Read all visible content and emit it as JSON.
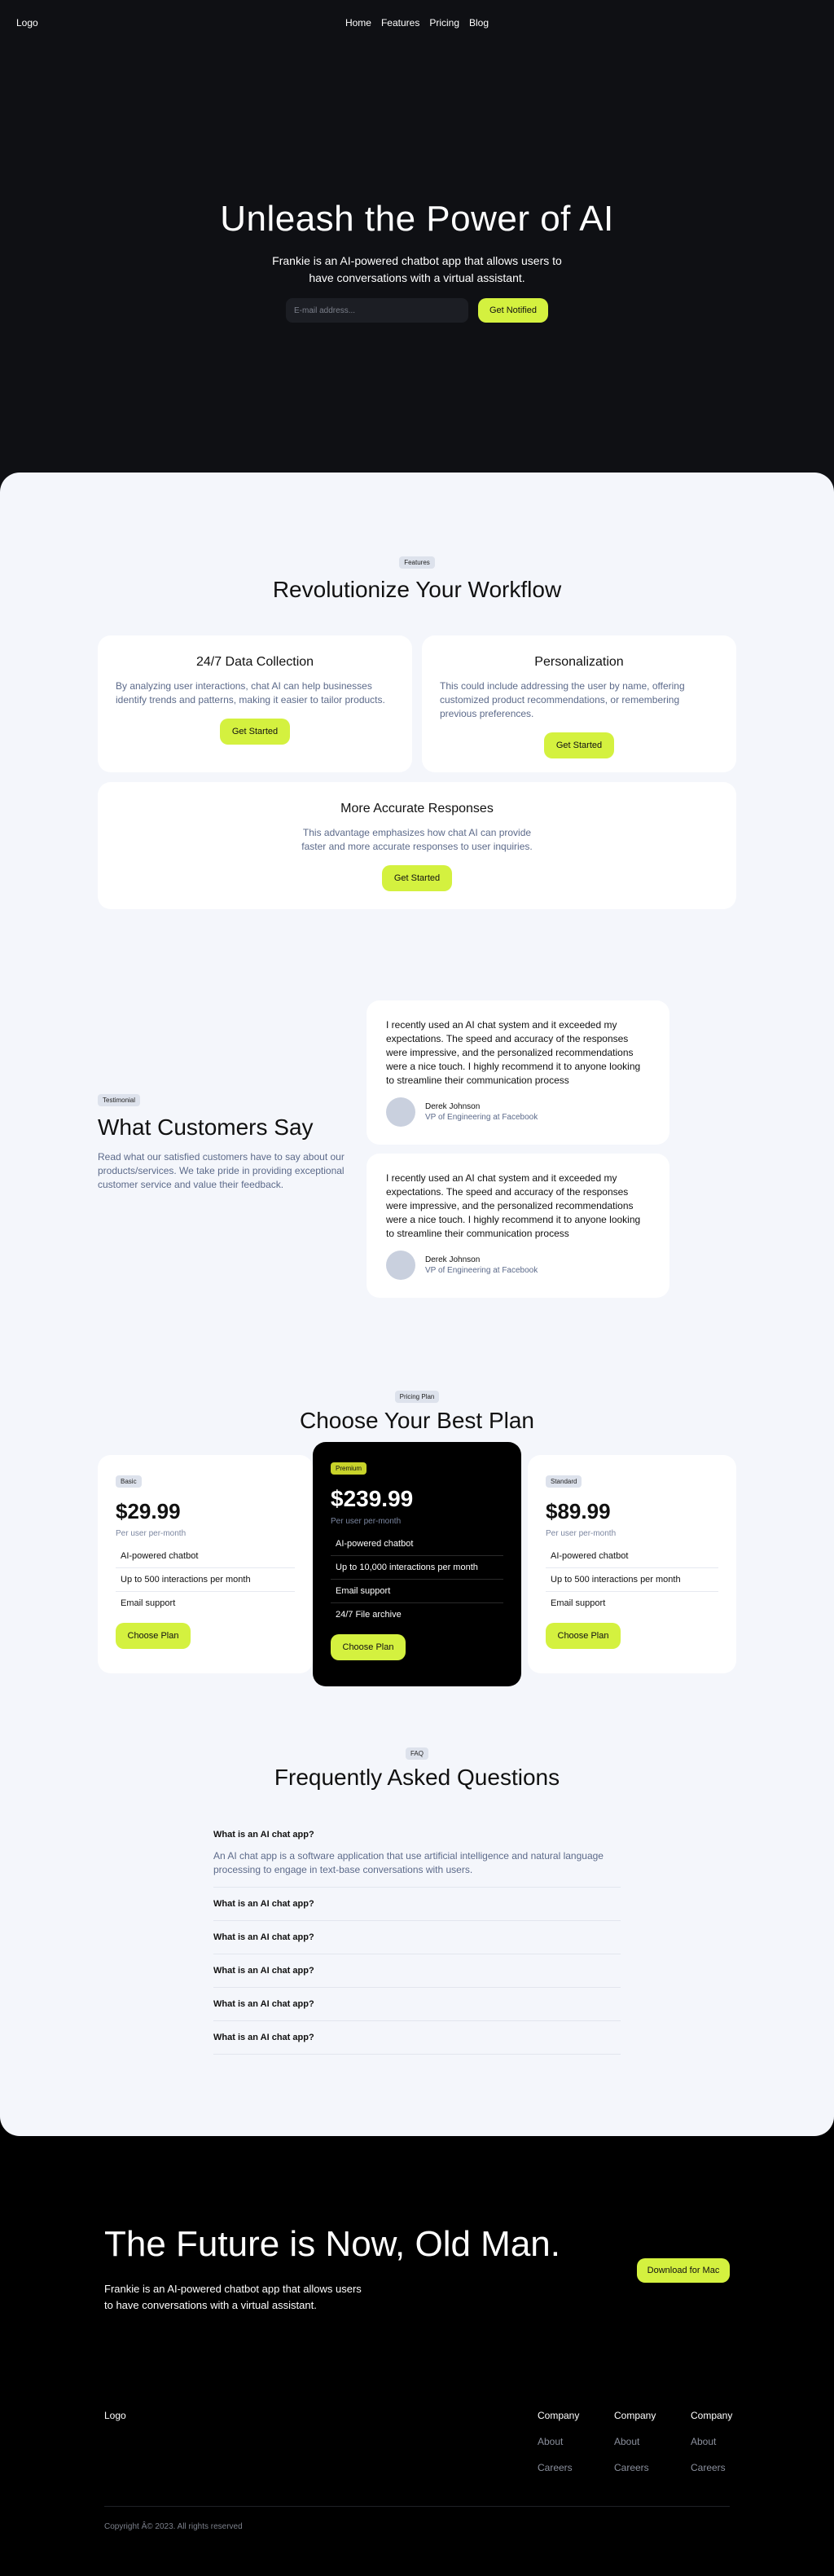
{
  "nav": {
    "logo": "Logo",
    "links": [
      "Home",
      "Features",
      "Pricing",
      "Blog"
    ]
  },
  "hero": {
    "title": "Unleash the Power of AI",
    "subtitle": "Frankie is an AI-powered chatbot app that allows users to have conversations with a virtual assistant.",
    "email_placeholder": "E-mail address...",
    "notify_label": "Get Notified"
  },
  "features": {
    "badge": "Features",
    "title": "Revolutionize Your Workflow",
    "cards": [
      {
        "title": "24/7 Data Collection",
        "text": "By analyzing user interactions, chat AI can help businesses identify trends and patterns, making it easier to tailor products.",
        "button": "Get Started"
      },
      {
        "title": "Personalization",
        "text": "This could include addressing the user by name, offering customized product recommendations, or remembering previous preferences.",
        "button": "Get Started"
      },
      {
        "title": "More Accurate Responses",
        "text": "This advantage emphasizes how chat AI can provide faster and more accurate responses to user inquiries.",
        "button": "Get Started"
      }
    ]
  },
  "testimonials": {
    "badge": "Testimonial",
    "title": "What Customers Say",
    "text": "Read what our satisfied customers have to say about our products/services. We take pride in providing exceptional customer service and value their feedback.",
    "items": [
      {
        "quote": "I recently used an AI chat system and it exceeded my expectations. The speed and accuracy of the responses were impressive, and the personalized recommendations were a nice touch. I highly recommend it to anyone looking to streamline their communication process",
        "name": "Derek Johnson",
        "role": "VP of Engineering at Facebook"
      },
      {
        "quote": "I recently used an AI chat system and it exceeded my expectations. The speed and accuracy of the responses were impressive, and the personalized recommendations were a nice touch. I highly recommend it to anyone looking to streamline their communication process",
        "name": "Derek Johnson",
        "role": "VP of Engineering at Facebook"
      }
    ]
  },
  "pricing": {
    "badge": "Pricing Plan",
    "title": "Choose Your Best Plan",
    "plans": [
      {
        "badge": "Basic",
        "price": "$29.99",
        "per": "Per user per-month",
        "features": [
          "AI-powered chatbot",
          "Up to 500 interactions per month",
          "Email support"
        ],
        "button": "Choose Plan"
      },
      {
        "badge": "Premium",
        "price": "$239.99",
        "per": "Per user per-month",
        "features": [
          "AI-powered chatbot",
          "Up to 10,000 interactions per month",
          "Email support",
          "24/7 File archive"
        ],
        "button": "Choose Plan"
      },
      {
        "badge": "Standard",
        "price": "$89.99",
        "per": "Per user per-month",
        "features": [
          "AI-powered chatbot",
          "Up to 500 interactions per month",
          "Email support"
        ],
        "button": "Choose Plan"
      }
    ]
  },
  "faq": {
    "badge": "FAQ",
    "title": "Frequently Asked Questions",
    "items": [
      {
        "q": "What is an AI chat app?",
        "a": "An AI chat app is a software application that use artificial intelligence and natural language processing to engage in text-base conversations with users."
      },
      {
        "q": "What is an AI chat app?"
      },
      {
        "q": "What is an AI chat app?"
      },
      {
        "q": "What is an AI chat app?"
      },
      {
        "q": "What is an AI chat app?"
      },
      {
        "q": "What is an AI chat app?"
      }
    ]
  },
  "cta": {
    "title": "The Future is Now, Old Man.",
    "text": "Frankie is an AI-powered chatbot app that allows users to have conversations with a virtual assistant.",
    "button": "Download for Mac"
  },
  "footer": {
    "logo": "Logo",
    "columns": [
      {
        "title": "Company",
        "links": [
          "About",
          "Careers"
        ]
      },
      {
        "title": "Company",
        "links": [
          "About",
          "Careers"
        ]
      },
      {
        "title": "Company",
        "links": [
          "About",
          "Careers"
        ]
      }
    ],
    "copyright": "Copyright Â© 2023. All rights reserved"
  },
  "colors": {
    "accent": "#d4f13f",
    "hero_bg": "#0f1014",
    "light_bg": "#f4f6fb",
    "muted_text": "#5c6a8a"
  }
}
